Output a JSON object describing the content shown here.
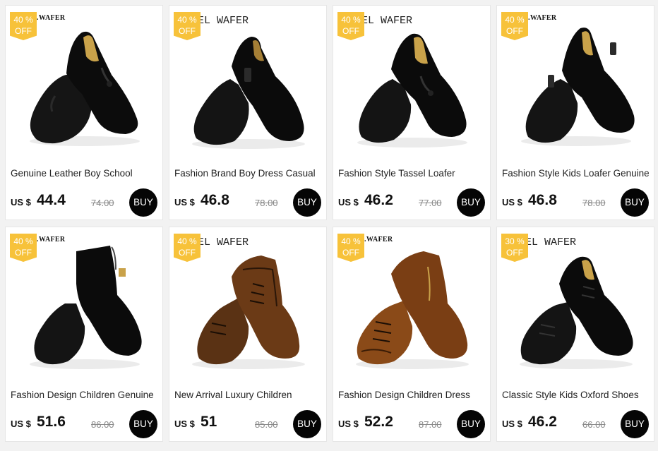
{
  "currency_label": "US $",
  "buy_label": "BUY",
  "badge_off_label": "OFF",
  "colors": {
    "badge": "#f7c23a",
    "buy_button": "#050505",
    "card": "#ffffff",
    "page": "#f2f2f2"
  },
  "products": [
    {
      "title": "Genuine Leather Boy School",
      "price": "44.4",
      "old_price": "74.00",
      "discount": "40 %",
      "brand_text": "WAFER",
      "shoe": "tassel-loafer-pair-black"
    },
    {
      "title": "Fashion Brand Boy Dress Casual",
      "price": "46.8",
      "old_price": "78.00",
      "discount": "40 %",
      "brand_text": "EL WAFER",
      "shoe": "monk-strap-black"
    },
    {
      "title": "Fashion Style Tassel Loafer",
      "price": "46.2",
      "old_price": "77.00",
      "discount": "40 %",
      "brand_text": "EL WAFER",
      "shoe": "tassel-loafer-black"
    },
    {
      "title": "Fashion Style Kids Loafer Genuine",
      "price": "46.8",
      "old_price": "78.00",
      "discount": "40 %",
      "brand_text": "WAFER",
      "shoe": "monk-strap-pair-black"
    },
    {
      "title": "Fashion Design Children Genuine",
      "price": "51.6",
      "old_price": "86.00",
      "discount": "40 %",
      "brand_text": "WAFER",
      "shoe": "chelsea-boot-pair-black"
    },
    {
      "title": "New Arrival Luxury Children",
      "price": "51",
      "old_price": "85.00",
      "discount": "40 %",
      "brand_text": "EL WAFER",
      "shoe": "lace-boot-pair-brown"
    },
    {
      "title": "Fashion Design Children Dress",
      "price": "52.2",
      "old_price": "87.00",
      "discount": "40 %",
      "brand_text": "WAFER",
      "shoe": "lace-boot-pair-tan"
    },
    {
      "title": "Classic Style Kids Oxford Shoes",
      "price": "46.2",
      "old_price": "66.00",
      "discount": "30 %",
      "brand_text": "EL WAFER",
      "shoe": "oxford-pair-black"
    }
  ]
}
